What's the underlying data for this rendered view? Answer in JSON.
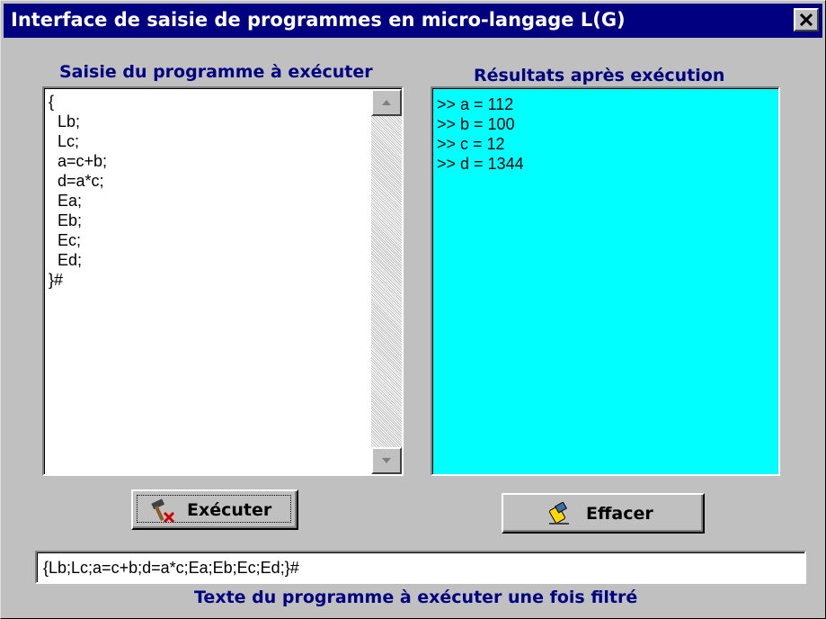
{
  "window": {
    "title": "Interface de saisie de programmes en micro-langage L(G)",
    "close_glyph": "close-icon"
  },
  "editor": {
    "label": "Saisie du programme à exécuter",
    "lines": [
      "{",
      "  Lb;",
      "  Lc;",
      "  a=c+b;",
      "  d=a*c;",
      "  Ea;",
      "  Eb;",
      "  Ec;",
      "  Ed;",
      "}#"
    ]
  },
  "results": {
    "label": "Résultats après exécution",
    "lines": [
      ">> a = 112",
      ">> b = 100",
      ">> c = 12",
      ">> d = 1344"
    ],
    "background": "#00ffff"
  },
  "buttons": {
    "execute_label": "Exécuter",
    "execute_icon": "hammer-icon",
    "clear_label": "Effacer",
    "clear_icon": "eraser-icon"
  },
  "filtered": {
    "value": "{Lb;Lc;a=c+b;d=a*c;Ea;Eb;Ec;Ed;}#",
    "caption": "Texte du programme à exécuter une fois filtré"
  },
  "colors": {
    "titlebar": "#000080",
    "label_text": "#000080",
    "window_bg": "#c0c0c0"
  }
}
